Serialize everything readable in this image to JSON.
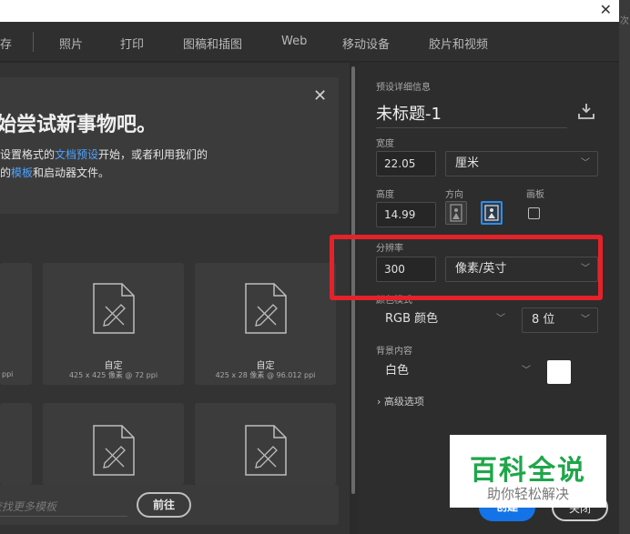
{
  "window": {
    "close_glyph": "✕",
    "edge_text": "次"
  },
  "tabs": [
    "存",
    "照片",
    "打印",
    "图稿和插图",
    "Web",
    "移动设备",
    "胶片和视频"
  ],
  "hero": {
    "close_glyph": "✕",
    "title": "始尝试新事物吧。",
    "line1_pre": "设置格式的",
    "line1_link": "文档预设",
    "line1_post": "开始，或者利用我们的",
    "line2_pre": "的",
    "line2_link": "模板",
    "line2_post": "和启动器文件。"
  },
  "cards": [
    {
      "title": "",
      "sub": "ppi"
    },
    {
      "title": "自定",
      "sub": "425 x 425 像素 @ 72 ppi"
    },
    {
      "title": "自定",
      "sub": "425 x 28 像素 @ 96.012 ppi"
    }
  ],
  "search": {
    "placeholder": "查找更多模板",
    "go_label": "前往"
  },
  "details": {
    "section_title": "预设详细信息",
    "doc_name": "未标题-1",
    "width_label": "宽度",
    "width_value": "22.05",
    "width_unit": "厘米",
    "height_label": "高度",
    "height_value": "14.99",
    "orientation_label": "方向",
    "artboard_label": "画板",
    "resolution_label": "分辨率",
    "resolution_value": "300",
    "resolution_unit": "像素/英寸",
    "color_mode_label": "颜色模式",
    "color_mode_value": "RGB 颜色",
    "bit_depth_value": "8 位",
    "background_label": "背景内容",
    "background_value": "白色",
    "background_swatch": "#ffffff",
    "advanced_label": "› 高级选项"
  },
  "buttons": {
    "create": "创建",
    "close": "关闭"
  },
  "watermark": {
    "title": "百科全说",
    "subtitle": "助你轻松解决"
  },
  "colors": {
    "accent": "#1473e6",
    "highlight": "#e5222a",
    "link": "#4da3ff",
    "watermark_green": "#1fa64a"
  },
  "icons": [
    "close-icon",
    "document-pencil-icon",
    "save-preset-icon",
    "portrait-icon",
    "landscape-icon",
    "chevron-down-icon"
  ]
}
